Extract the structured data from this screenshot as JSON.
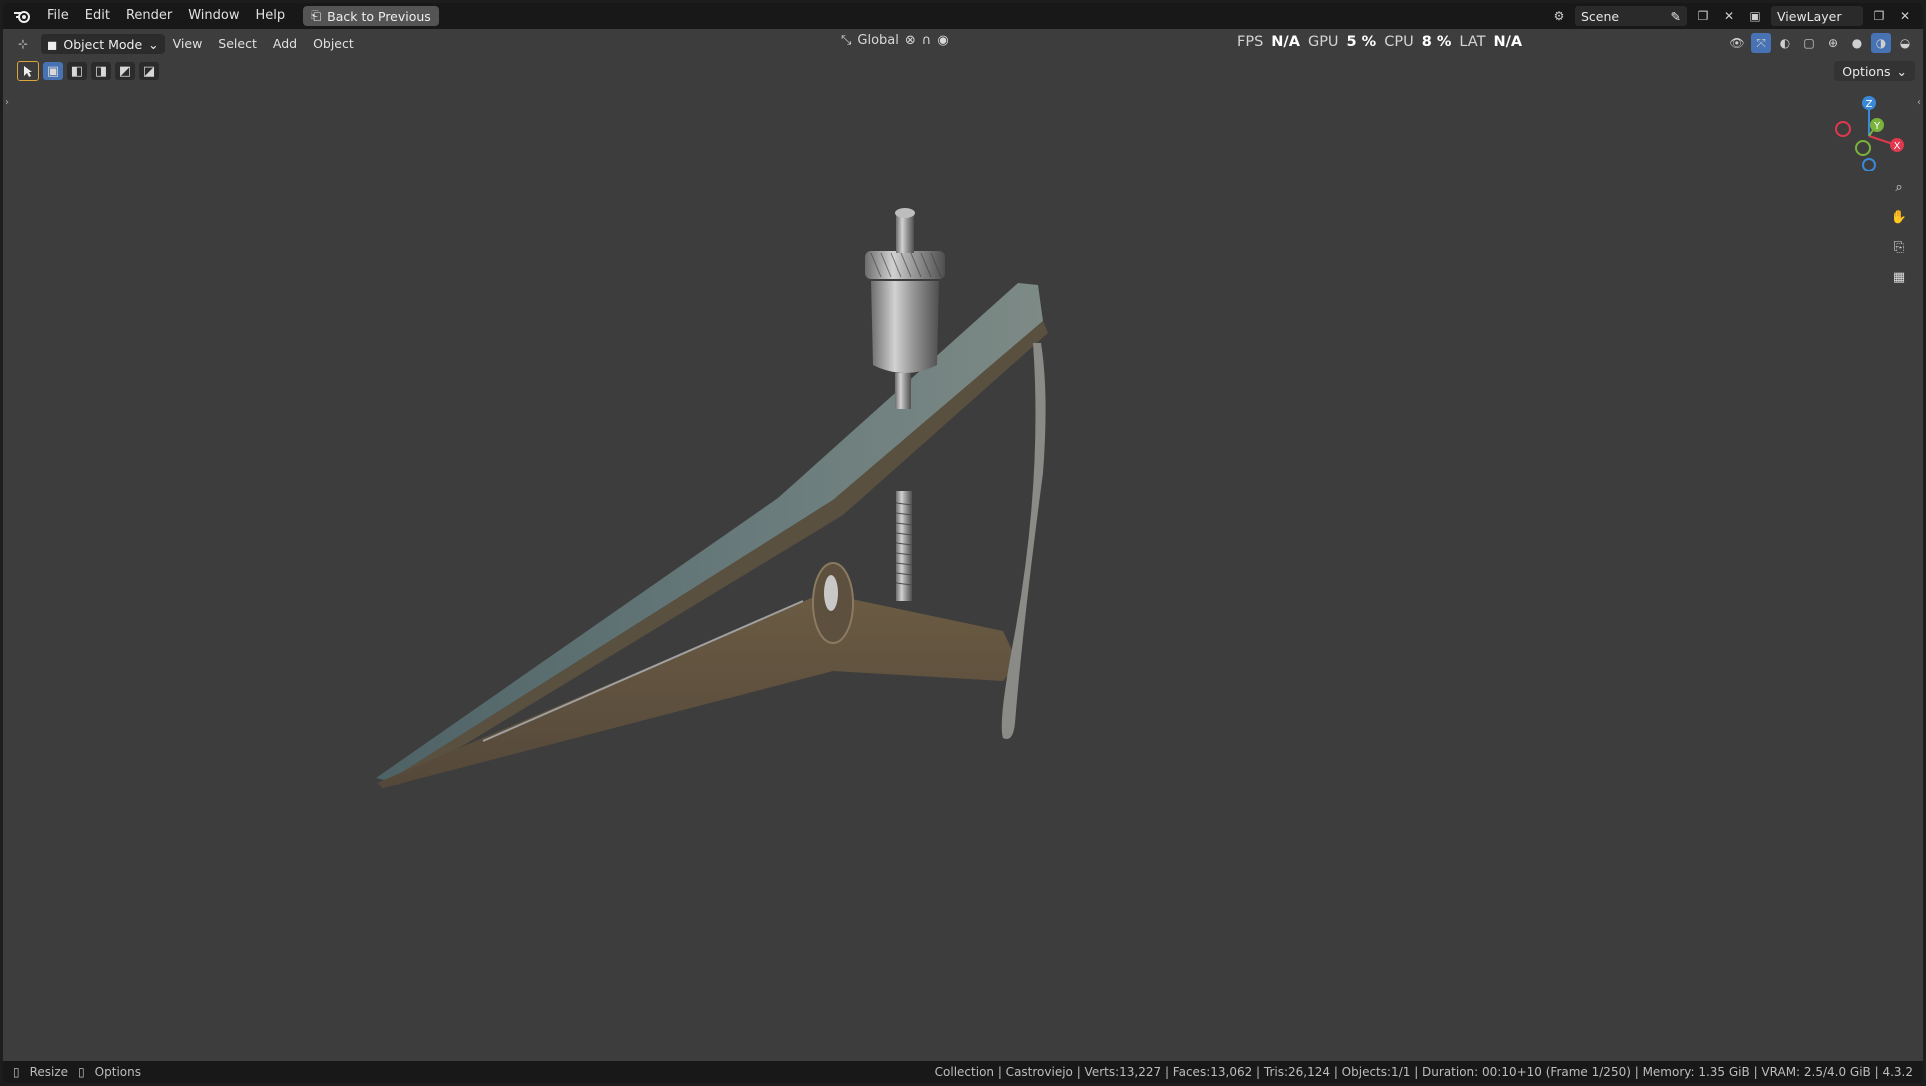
{
  "menu": {
    "items": [
      "File",
      "Edit",
      "Render",
      "Window",
      "Help"
    ],
    "back_button": "Back to Previous"
  },
  "top_right": {
    "scene": "Scene",
    "view_layer": "ViewLayer"
  },
  "header": {
    "mode": "Object Mode",
    "items": [
      "View",
      "Select",
      "Add",
      "Object"
    ],
    "transform_orientation": "Global"
  },
  "stats": {
    "fps_label": "FPS",
    "fps_value": "N/A",
    "gpu_label": "GPU",
    "gpu_value": "5 %",
    "cpu_label": "CPU",
    "cpu_value": "8 %",
    "lat_label": "LAT",
    "lat_value": "N/A"
  },
  "viewport": {
    "options_label": "Options",
    "gizmo": {
      "z": "Z",
      "y": "Y",
      "x": "X",
      "colors": {
        "x": "#e0384e",
        "y": "#7ab33b",
        "z": "#3a88d8"
      }
    }
  },
  "status": {
    "left_1": "Resize",
    "left_2": "Options",
    "right": "Collection | Castroviejo | Verts:13,227 | Faces:13,062 | Tris:26,124 | Objects:1/1 | Duration: 00:10+10 (Frame 1/250) | Memory: 1.35 GiB | VRAM: 2.5/4.0 GiB | 4.3.2"
  },
  "icons": [
    "blender-logo-icon",
    "back-icon",
    "scene-icon",
    "pin-icon",
    "new-scene-icon",
    "close-icon",
    "viewlayer-icon",
    "editor-type-icon",
    "object-mode-icon",
    "transform-icon",
    "pivot-icon",
    "snap-icon",
    "proportional-icon",
    "visibility-icon",
    "gizmo-icon",
    "overlay-icon",
    "xray-icon",
    "wireframe-icon",
    "solid-icon",
    "material-icon",
    "rendered-icon",
    "select-box-icon",
    "zoom-icon",
    "pan-hand-icon",
    "camera-icon",
    "grid-icon"
  ]
}
